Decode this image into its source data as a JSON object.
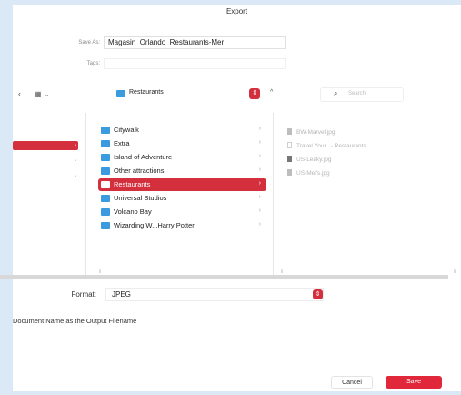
{
  "dialog": {
    "title": "Export"
  },
  "save_as": {
    "label": "Save As:",
    "value": "Magasin_Orlando_Restaurants-Mer"
  },
  "tags": {
    "label": "Tags:",
    "value": ""
  },
  "toolbar": {
    "view_icon": "grid-view-icon",
    "location": "Restaurants",
    "search_placeholder": "Search"
  },
  "folders": [
    {
      "name": "Citywalk"
    },
    {
      "name": "Extra"
    },
    {
      "name": "Island of Adventure"
    },
    {
      "name": "Other attractions"
    },
    {
      "name": "Restaurants",
      "selected": true
    },
    {
      "name": "Universal Studios"
    },
    {
      "name": "Volcano Bay"
    },
    {
      "name": "Wizarding W...Harry Potter"
    }
  ],
  "files": [
    {
      "name": "BW-Marvel.jpg",
      "icon": "image-file-icon"
    },
    {
      "name": "Travel Your...- Restaurants",
      "icon": "document-icon"
    },
    {
      "name": "US-Leaky.jpg",
      "icon": "image-file-icon"
    },
    {
      "name": "US-Mel's.jpg",
      "icon": "image-file-icon"
    }
  ],
  "format": {
    "label": "Format:",
    "value": "JPEG"
  },
  "note": "Document Name as the Output Filename",
  "buttons": {
    "cancel": "Cancel",
    "save": "Save"
  },
  "colors": {
    "accent": "#d32f3d",
    "folder": "#3a9be0",
    "frame": "#dbe9f7"
  }
}
